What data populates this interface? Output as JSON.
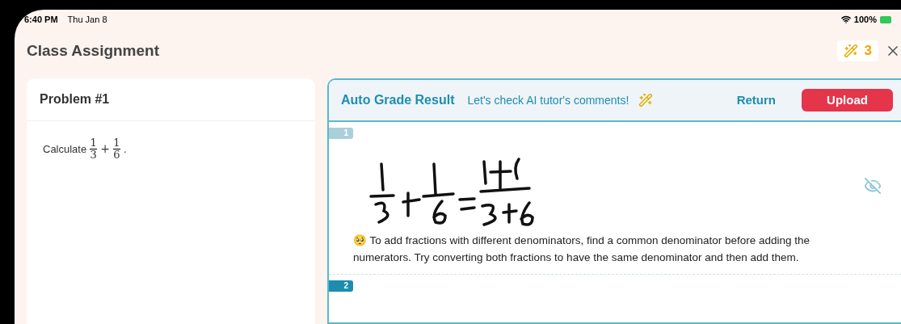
{
  "status_bar": {
    "time": "6:40 PM",
    "date": "Thu Jan 8",
    "battery": "100%"
  },
  "header": {
    "title": "Class Assignment",
    "credits": "3"
  },
  "problem": {
    "title": "Problem #1",
    "prefix": "Calculate",
    "operator": "+",
    "suffix": ".",
    "fractions": [
      {
        "numerator": "1",
        "denominator": "3"
      },
      {
        "numerator": "1",
        "denominator": "6"
      }
    ]
  },
  "result": {
    "title": "Auto Grade Result",
    "hint": "Let's check AI tutor's comments!",
    "return_label": "Return",
    "upload_label": "Upload",
    "answers": [
      {
        "number": "1",
        "selected": false,
        "emoji": "🥺",
        "comment": "To add fractions with different denominators, find a common denominator before adding the numerators. Try converting both fractions to have the same denominator and then add them."
      },
      {
        "number": "2",
        "selected": true
      }
    ]
  }
}
